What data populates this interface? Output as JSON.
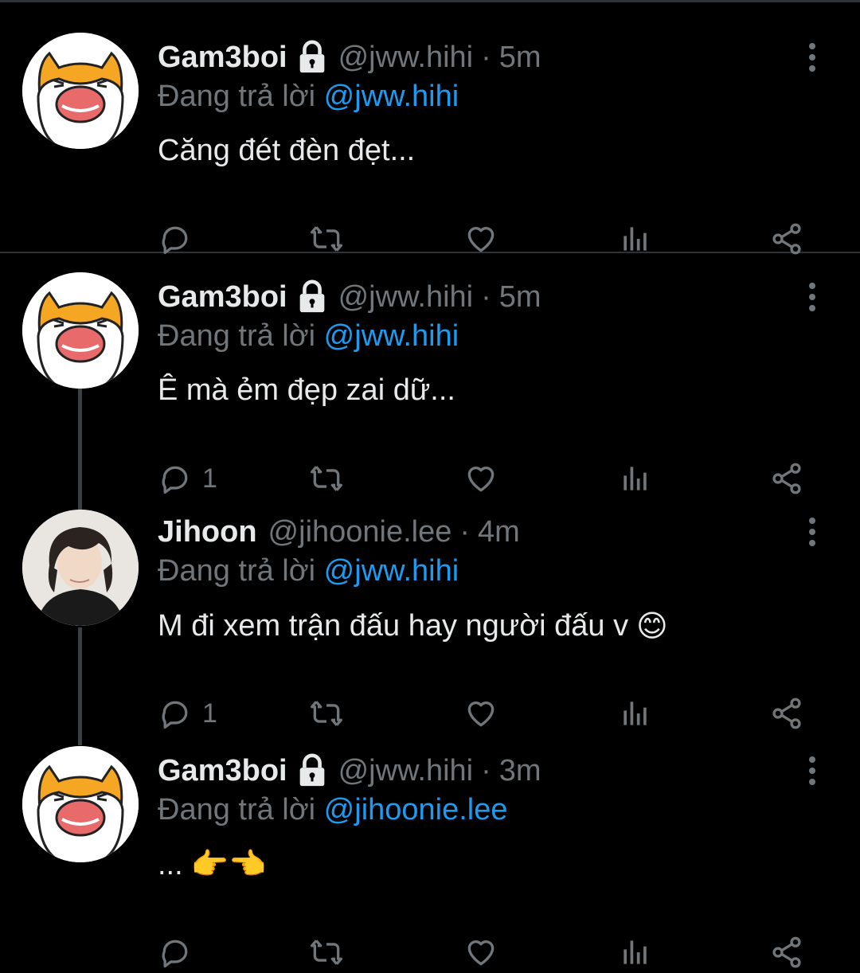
{
  "tweets": [
    {
      "name": "Gam3boi",
      "handle": "@jww.hihi",
      "dot": "·",
      "time": "5m",
      "reply_prefix": "Đang trả lời",
      "reply_to": "@jww.hihi",
      "text": "Căng đét đèn đẹt...",
      "reply_count": "",
      "avatar": "cat",
      "locked": true
    },
    {
      "name": "Gam3boi",
      "handle": "@jww.hihi",
      "dot": "·",
      "time": "5m",
      "reply_prefix": "Đang trả lời",
      "reply_to": "@jww.hihi",
      "text": "Ê mà ẻm đẹp zai dữ...",
      "reply_count": "1",
      "avatar": "cat",
      "locked": true
    },
    {
      "name": "Jihoon",
      "handle": "@jihoonie.lee",
      "dot": "·",
      "time": "4m",
      "reply_prefix": "Đang trả lời",
      "reply_to": "@jww.hihi",
      "text": "M đi xem trận đấu hay người đấu v",
      "emoji": "😊",
      "reply_count": "1",
      "avatar": "photo",
      "locked": false
    },
    {
      "name": "Gam3boi",
      "handle": "@jww.hihi",
      "dot": "·",
      "time": "3m",
      "reply_prefix": "Đang trả lời",
      "reply_to": "@jihoonie.lee",
      "text": "...",
      "emoji": "👉👈",
      "reply_count": "",
      "avatar": "cat",
      "locked": true
    }
  ],
  "icons": {
    "reply": "reply-icon",
    "retweet": "retweet-icon",
    "like": "heart-icon",
    "views": "analytics-icon",
    "share": "share-icon",
    "more": "more-options-icon",
    "lock": "lock-icon"
  },
  "colors": {
    "background": "#000000",
    "text": "#e7e9ea",
    "muted": "#71767b",
    "mention": "#1d9bf0",
    "divider": "#2f3336"
  }
}
